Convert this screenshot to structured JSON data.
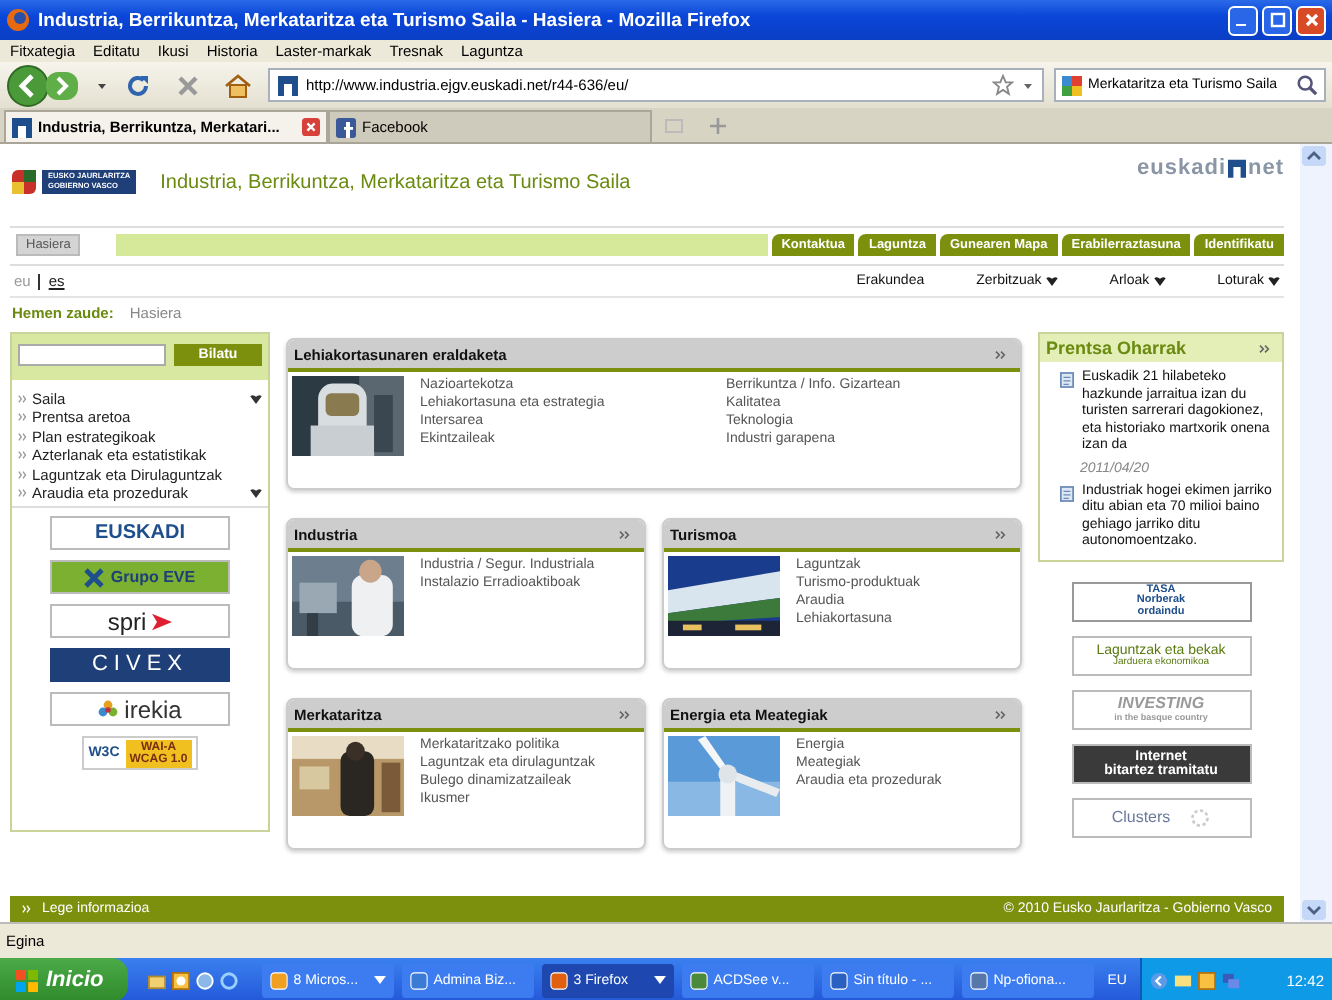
{
  "window": {
    "title": "Industria, Berrikuntza, Merkataritza eta Turismo Saila - Hasiera - Mozilla Firefox"
  },
  "menu": [
    "Fitxategia",
    "Editatu",
    "Ikusi",
    "Historia",
    "Laster-markak",
    "Tresnak",
    "Laguntza"
  ],
  "toolbar": {
    "url": "http://www.industria.ejgv.euskadi.net/r44-636/eu/",
    "search": "Merkataritza eta Turismo Saila"
  },
  "tabs": [
    {
      "label": "Industria, Berrikuntza, Merkatari...",
      "selected": true
    },
    {
      "label": "Facebook",
      "selected": false
    }
  ],
  "page": {
    "header": {
      "logo_lines": [
        "EUSKO JAURLARITZA",
        "GOBIERNO VASCO"
      ],
      "title": "Industria, Berrikuntza, Merkataritza eta Turismo Saila",
      "brand": "euskadi",
      "brand_suffix": "net"
    },
    "nav": {
      "home": "Hasiera",
      "links": [
        "Kontaktua",
        "Laguntza",
        "Gunearen Mapa",
        "Erabilerraztasuna",
        "Identifikatu"
      ]
    },
    "languages": [
      {
        "label": "eu",
        "selected": true
      },
      {
        "label": "es",
        "selected": false
      }
    ],
    "menus": [
      {
        "label": "Erakundea",
        "dropdown": false
      },
      {
        "label": "Zerbitzuak",
        "dropdown": true
      },
      {
        "label": "Arloak",
        "dropdown": true
      },
      {
        "label": "Loturak",
        "dropdown": true
      }
    ],
    "breadcrumb": {
      "label": "Hemen zaude:",
      "path": "Hasiera"
    },
    "search": {
      "button": "Bilatu"
    },
    "sidebar": {
      "items": [
        {
          "label": "Saila",
          "expandable": true
        },
        {
          "label": "Prentsa aretoa",
          "expandable": false
        },
        {
          "label": "Plan estrategikoak",
          "expandable": false
        },
        {
          "label": "Azterlanak eta estatistikak",
          "expandable": false
        },
        {
          "label": "Laguntzak eta Dirulaguntzak",
          "expandable": false
        },
        {
          "label": "Araudia eta prozedurak",
          "expandable": true
        }
      ]
    },
    "left_banners": [
      {
        "kind": "euskadi",
        "lines": [
          "EUSKADI"
        ]
      },
      {
        "kind": "eve",
        "lines": [
          "Grupo EVE"
        ]
      },
      {
        "kind": "spri",
        "lines": [
          "spri"
        ]
      },
      {
        "kind": "civex",
        "lines": [
          "CIVEX"
        ]
      },
      {
        "kind": "irekia",
        "lines": [
          "irekia"
        ]
      },
      {
        "kind": "w3c",
        "lines": [
          "W3C",
          "WAI-A",
          "WCAG 1.0"
        ]
      }
    ],
    "sections": [
      {
        "kind": "wide",
        "title": "Lehiakortasunaren eraldaketa",
        "columns": [
          [
            "Nazioartekotza",
            "Lehiakortasuna eta estrategia",
            "Intersarea",
            "Ekintzaileak"
          ],
          [
            "Berrikuntza / Info. Gizartean",
            "Kalitatea",
            "Teknologia",
            "Industri garapena"
          ]
        ]
      },
      {
        "kind": "half",
        "title": "Industria",
        "columns": [
          [
            "Industria / Segur. Industriala",
            "Instalazio Erradioaktiboak"
          ]
        ]
      },
      {
        "kind": "half",
        "title": "Turismoa",
        "columns": [
          [
            "Laguntzak",
            "Turismo-produktuak",
            "Araudia",
            "Lehiakortasuna"
          ]
        ]
      },
      {
        "kind": "half",
        "title": "Merkataritza",
        "columns": [
          [
            "Merkataritzako politika",
            "Laguntzak eta dirulaguntzak",
            "Bulego dinamizatzaileak",
            "Ikusmer"
          ]
        ]
      },
      {
        "kind": "half",
        "title": "Energia eta Meategiak",
        "columns": [
          [
            "Energia",
            "Meategiak",
            "Araudia eta prozedurak"
          ]
        ]
      }
    ],
    "press": {
      "title": "Prentsa Oharrak",
      "items": [
        {
          "text": "Euskadik 21 hilabeteko hazkunde jarraitua izan du turisten sarrerari dagokionez, eta historiako martxorik onena izan da",
          "date": "2011/04/20"
        },
        {
          "text": "Industriak hogei ekimen jarriko ditu abian eta 70 milioi baino gehiago jarriko ditu autonomoentzako."
        }
      ]
    },
    "right_banners": [
      {
        "kind": "tasa",
        "lines": [
          "TASA",
          "Norberak",
          "ordaindu"
        ]
      },
      {
        "kind": "laguntzak",
        "lines": [
          "Laguntzak eta bekak",
          "Jarduera ekonomikoa"
        ]
      },
      {
        "kind": "investing",
        "lines": [
          "INVESTING",
          "in the basque country"
        ]
      },
      {
        "kind": "internet",
        "lines": [
          "Internet",
          "bitartez tramitatu"
        ]
      },
      {
        "kind": "clusters",
        "lines": [
          "Clusters"
        ]
      }
    ],
    "footer": {
      "link": "Lege informazioa",
      "copyright": "© 2010 Eusko Jaurlaritza - Gobierno Vasco"
    }
  },
  "status_bar": "Egina",
  "taskbar": {
    "start": "Inicio",
    "tasks": [
      {
        "label": "8 Micros...",
        "selected": false,
        "dropdown": true
      },
      {
        "label": "Admina Biz...",
        "selected": false,
        "dropdown": false
      },
      {
        "label": "3 Firefox",
        "selected": true,
        "dropdown": true
      },
      {
        "label": "ACDSee v...",
        "selected": false,
        "dropdown": false
      },
      {
        "label": "Sin título - ...",
        "selected": false,
        "dropdown": false
      },
      {
        "label": "Np-ofiona...",
        "selected": false,
        "dropdown": false
      }
    ],
    "language": "EU",
    "clock": "12:42"
  }
}
